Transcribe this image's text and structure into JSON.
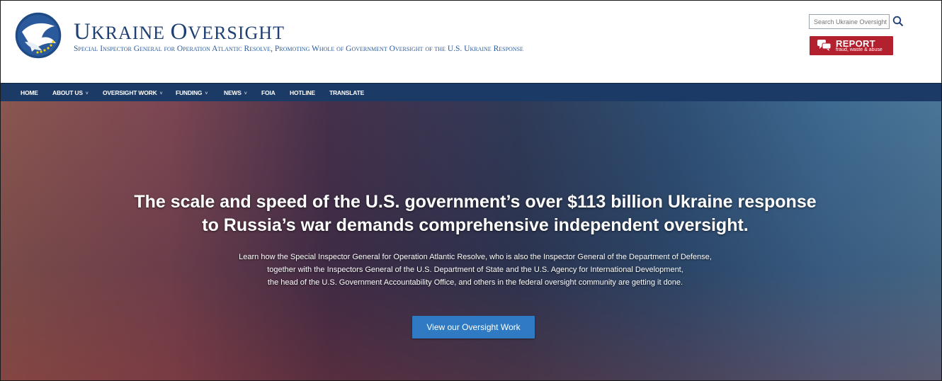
{
  "header": {
    "title_first_initial": "U",
    "title_first_rest": "KRAINE",
    "title_second_initial": "O",
    "title_second_rest": "VERSIGHT",
    "subtitle": "Special Inspector General for Operation Atlantic Resolve, Promoting Whole of Government Oversight of the U.S. Ukraine Response"
  },
  "search": {
    "placeholder": "Search Ukraine Oversight",
    "icon": "search-icon"
  },
  "report": {
    "label": "REPORT",
    "sublabel": "fraud, waste & abuse",
    "color": "#b3212f",
    "icon": "chat-bubbles-icon"
  },
  "nav": {
    "items": [
      {
        "label": "HOME",
        "dropdown": false
      },
      {
        "label": "ABOUT US",
        "dropdown": true
      },
      {
        "label": "OVERSIGHT WORK",
        "dropdown": true
      },
      {
        "label": "FUNDING",
        "dropdown": true
      },
      {
        "label": "NEWS",
        "dropdown": true
      },
      {
        "label": "FOIA",
        "dropdown": false
      },
      {
        "label": "HOTLINE",
        "dropdown": false
      },
      {
        "label": "TRANSLATE",
        "dropdown": false
      }
    ],
    "chevron": "˅",
    "color": "#1b3a66"
  },
  "hero": {
    "title_line1": "The scale and speed of the U.S. government’s over $113 billion Ukraine response",
    "title_line2": "to Russia’s war demands comprehensive independent oversight.",
    "body_line1": "Learn how the Special Inspector General for Operation Atlantic Resolve, who is also the Inspector General of the Department of Defense,",
    "body_line2": "together with the Inspectors General of the U.S. Department of State and the U.S. Agency for International Development,",
    "body_line3": "the head of the U.S. Government Accountability Office, and others in the federal oversight community are getting it done.",
    "cta_label": "View our Oversight Work",
    "cta_color": "#2f7ac2"
  }
}
